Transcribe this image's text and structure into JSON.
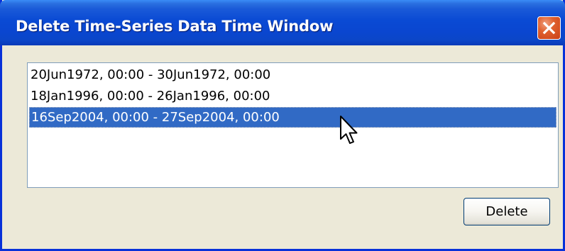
{
  "window": {
    "title": "Delete Time-Series Data Time Window",
    "close_icon": "close-x-icon"
  },
  "list": {
    "items": [
      {
        "label": "20Jun1972, 00:00 - 30Jun1972, 00:00",
        "selected": false
      },
      {
        "label": "18Jan1996, 00:00 - 26Jan1996, 00:00",
        "selected": false
      },
      {
        "label": "16Sep2004, 00:00 - 27Sep2004, 00:00",
        "selected": true
      }
    ]
  },
  "buttons": {
    "delete_label": "Delete"
  },
  "colors": {
    "titlebar": "#0a4ad4",
    "selection": "#316ac5",
    "window_bg": "#ece9d8",
    "close_button": "#e0602e"
  },
  "pointer": {
    "icon": "mouse-pointer-icon"
  }
}
